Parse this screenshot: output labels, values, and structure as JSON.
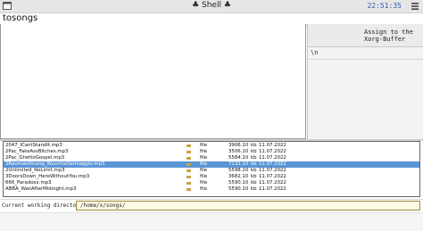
{
  "titlebar": {
    "title": "♣ Shell ♣",
    "clock": "22:51:35"
  },
  "window": {
    "name": "tosongs"
  },
  "side_panel": {
    "caption": "Assign to the\nXorg-Buffer",
    "line": "\\n"
  },
  "file_list": {
    "rows": [
      {
        "name": "2047_ICantStandIt.mp3",
        "type": "file",
        "size": "3906.10",
        "unit": "kb",
        "date": "11.07.2022",
        "selected": false
      },
      {
        "name": "2Pac_FakeAssBitches.mp3",
        "type": "file",
        "size": "3506.10",
        "unit": "kb",
        "date": "11.07.2022",
        "selected": false
      },
      {
        "name": "2Pac_GhettoGospel.mp3",
        "type": "file",
        "size": "5584.10",
        "unit": "kb",
        "date": "11.07.2022",
        "selected": false
      },
      {
        "name": "2Raumwohnung_WucchioSelmaggio.mp3",
        "type": "file",
        "size": "7132.10",
        "unit": "kb",
        "date": "11.07.2022",
        "selected": true
      },
      {
        "name": "2Unlimited_NoLimit.mp3",
        "type": "file",
        "size": "5598.10",
        "unit": "kb",
        "date": "11.07.2022",
        "selected": false
      },
      {
        "name": "3DoorsDown_HereWithoutYou.mp3",
        "type": "file",
        "size": "3682.10",
        "unit": "kb",
        "date": "11.07.2022",
        "selected": false
      },
      {
        "name": "666_Paradoxx.mp3",
        "type": "file",
        "size": "5590.10",
        "unit": "kb",
        "date": "11.07.2022",
        "selected": false
      },
      {
        "name": "ABBA_WanAfterMidnight.mp3",
        "type": "file",
        "size": "5590.10",
        "unit": "kb",
        "date": "11.07.2022",
        "selected": false
      }
    ]
  },
  "cwd": {
    "label": "Current working directory →",
    "value": "/home/x/songs/"
  },
  "colors": {
    "selection": "#5a95d6",
    "clock": "#3060b0",
    "input_bg": "#fffbe5"
  },
  "icons": {
    "window": "terminal-icon",
    "menu": "menu-icon",
    "file": "folder-icon"
  }
}
